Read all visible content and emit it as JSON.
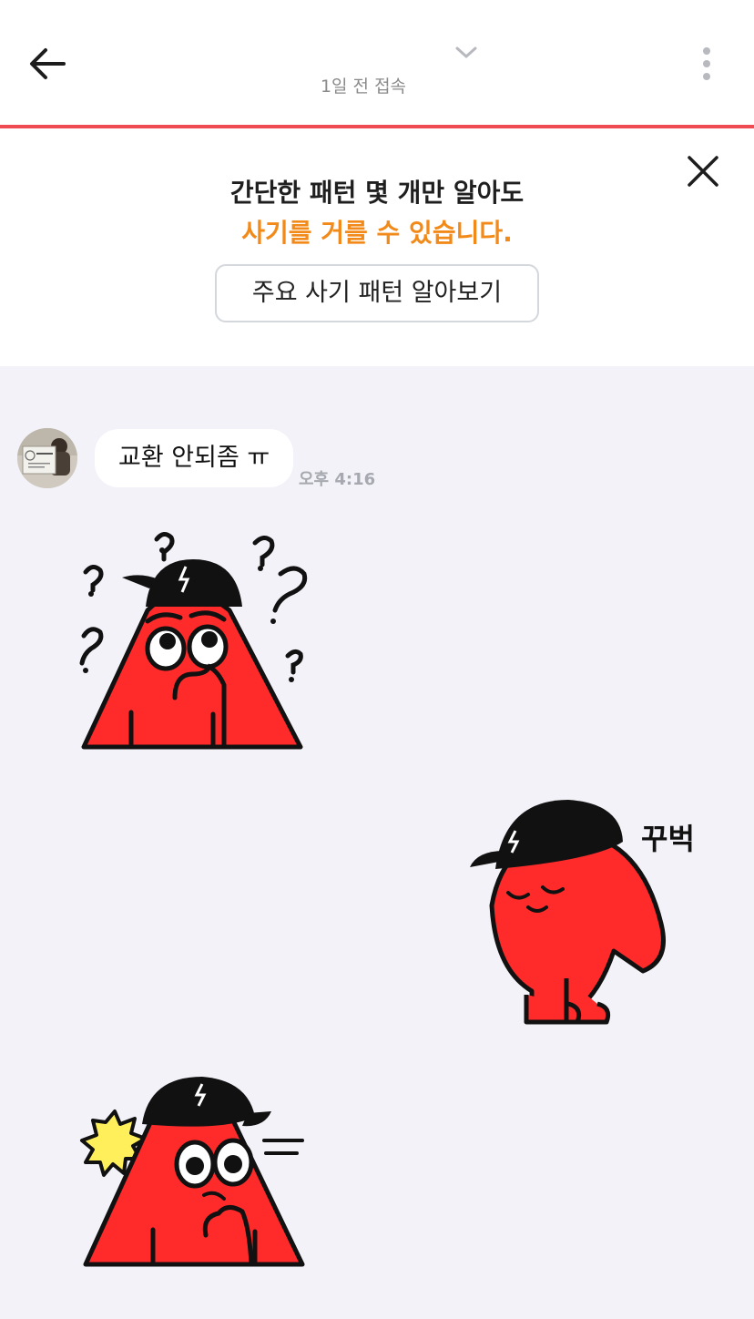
{
  "header": {
    "status": "1일 전 접속",
    "back_icon": "arrow-left-icon",
    "chevron_icon": "chevron-down-icon",
    "more_icon": "more-vertical-icon"
  },
  "notice": {
    "line1": "간단한 패턴 몇 개만 알아도",
    "line2": "사기를 거를 수 있습니다.",
    "button_label": "주요 사기 패턴 알아보기",
    "close_icon": "close-icon",
    "accent_color": "#f28a1a"
  },
  "messages": [
    {
      "text": "교환 안되좀 ㅠ",
      "time": "오후 4:16"
    }
  ],
  "stickers": [
    {
      "caption": ""
    },
    {
      "caption": "꾸벅"
    },
    {
      "caption": ""
    }
  ],
  "colors": {
    "header_underline": "#f04a52",
    "chat_background": "#f2f2f8",
    "sticker_red": "#ff2b2b"
  }
}
